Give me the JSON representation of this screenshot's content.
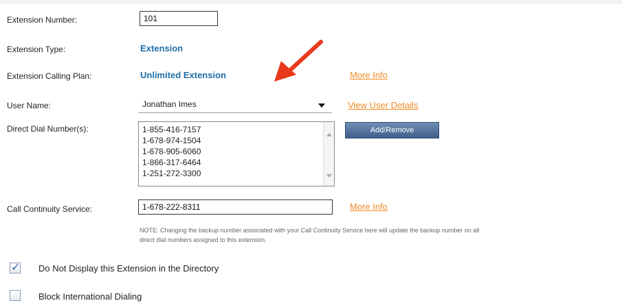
{
  "fields": {
    "extension_number": {
      "label": "Extension Number:",
      "value": "101"
    },
    "extension_type": {
      "label": "Extension Type:",
      "value": "Extension"
    },
    "calling_plan": {
      "label": "Extension Calling Plan:",
      "value": "Unlimited Extension",
      "link": "More Info"
    },
    "user_name": {
      "label": "User Name:",
      "value": "Jonathan Imes",
      "link": "View User Details"
    },
    "direct_dial": {
      "label": "Direct Dial Number(s):",
      "numbers": [
        "1-855-416-7157",
        "1-678-974-1504",
        "1-678-905-6060",
        "1-866-317-6464",
        "1-251-272-3300"
      ],
      "button": "Add/Remove"
    },
    "call_continuity": {
      "label": "Call Continuity Service:",
      "value": "1-678-222-8311",
      "link": "More Info",
      "note_line1": "NOTE: Changing the backup number associated with your Call Continuity Service here will update the backup number on all",
      "note_line2": "direct dial numbers assigned to this extension."
    }
  },
  "options": {
    "hide_directory": {
      "label": "Do Not Display this Extension in the Directory",
      "checked": true
    },
    "block_international": {
      "label": "Block International Dialing",
      "checked": false
    }
  },
  "colors": {
    "accent_blue": "#1f6ea8",
    "link_orange": "#f08a24",
    "annotation_arrow": "#e8391c"
  },
  "annotation": {
    "icon": "red-arrow-icon"
  }
}
